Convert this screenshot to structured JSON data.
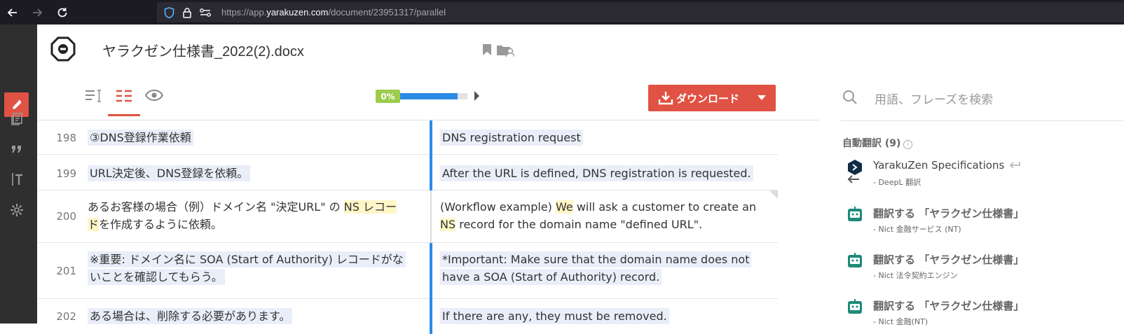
{
  "browser": {
    "url_prefix": "https://app.",
    "url_domain": "yarakuzen.com",
    "url_path": "/document/23951317/parallel"
  },
  "document": {
    "title": "ヤラクゼン仕様書_2022(2).docx"
  },
  "toolbar": {
    "progress_label": "0%",
    "progress_fraction": 0.85,
    "download_label": "ダウンロード"
  },
  "segments": [
    {
      "num": "198",
      "source": "③DNS登録作業依頼",
      "target": "DNS registration request"
    },
    {
      "num": "199",
      "source": "URL決定後、DNS登録を依頼。",
      "target": "After the URL is defined, DNS registration is requested."
    },
    {
      "num": "200",
      "source_a": "あるお客様の場合（例）ドメイン名 \"決定URL\" の ",
      "source_hl": "NS レコー",
      "source_hl2": "ド",
      "source_b": "を作成するように依頼。",
      "target_a": "(Workflow example) ",
      "target_hl": "We",
      "target_b": " will ask a customer to create an ",
      "target_hl2": "NS",
      "target_c": " record for the domain name \"defined URL\"."
    },
    {
      "num": "201",
      "source": "※重要: ドメイン名に SOA (Start of Authority) レコードがないことを確認してもらう。",
      "target": "*Important: Make sure that the domain name does not have a SOA (Start of Authority) record."
    },
    {
      "num": "202",
      "source": "ある場合は、削除する必要があります。",
      "target": "If there are any, they must be removed."
    }
  ],
  "panel": {
    "search_placeholder": "用語、フレーズを検索",
    "heading": "自動翻訳 (9)",
    "items": [
      {
        "title": "YarakuZen Specifications",
        "sub": "- DeepL 翻訳",
        "icon": "deepl-icon"
      },
      {
        "title": "翻訳する 「ヤラクゼン仕様書」",
        "sub": "- Nict 金融サービス (NT)",
        "icon": "robot-icon"
      },
      {
        "title": "翻訳する 「ヤラクゼン仕様書」",
        "sub": "- Nict 法令契約エンジン",
        "icon": "robot-icon"
      },
      {
        "title": "翻訳する 「ヤラクゼン仕様書」",
        "sub": "- Nict 金融(NT)",
        "icon": "robot-icon"
      }
    ]
  },
  "colors": {
    "accent": "#e05243",
    "progress": "#2b8be6",
    "progress_badge": "#9ccc4b",
    "teal": "#1d8a7a"
  }
}
